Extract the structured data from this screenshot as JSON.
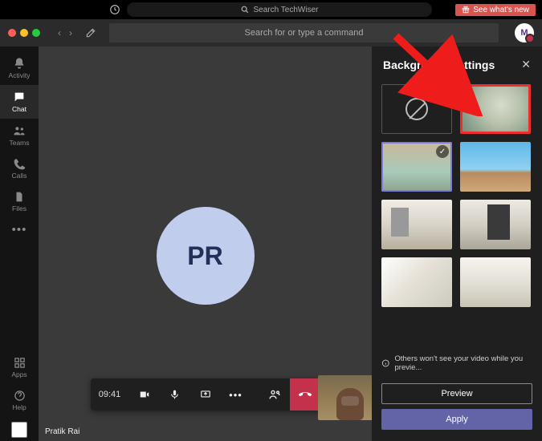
{
  "topbar1": {
    "search_placeholder": "Search TechWiser",
    "see_new_label": "See what's new"
  },
  "topbar2": {
    "command_placeholder": "Search for or type a command",
    "avatar_initial": "M"
  },
  "rail": {
    "activity": "Activity",
    "chat": "Chat",
    "teams": "Teams",
    "calls": "Calls",
    "files": "Files",
    "more": "•••",
    "apps": "Apps",
    "help": "Help"
  },
  "call": {
    "avatar_initials": "PR",
    "duration": "09:41",
    "footer_name": "Pratik Rai"
  },
  "panel": {
    "title": "Background settings",
    "info": "Others won't see your video while you previe...",
    "preview_label": "Preview",
    "apply_label": "Apply"
  }
}
